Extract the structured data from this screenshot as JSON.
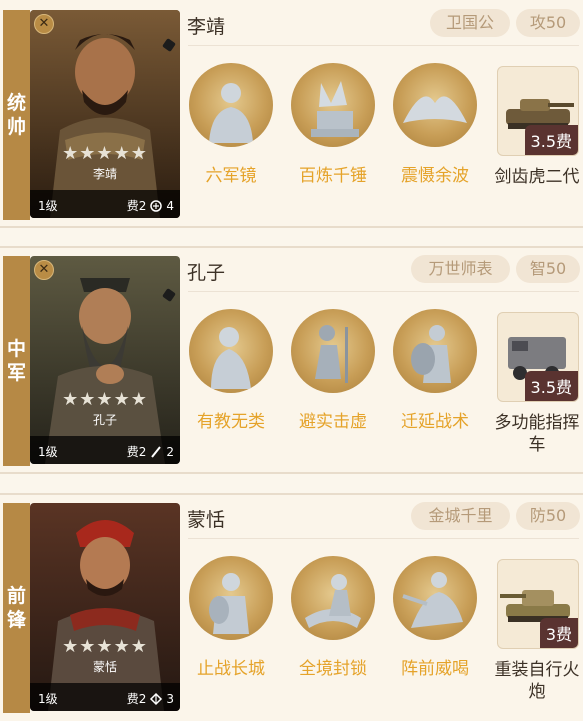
{
  "cards": [
    {
      "role": "统帅",
      "general": {
        "name": "李靖",
        "stars": "★★★★★",
        "level": "1级",
        "cost": "费2",
        "unit_count": "4"
      },
      "tags": [
        "卫国公",
        "攻50"
      ],
      "skills": [
        "六军镜",
        "百炼千锤",
        "震慑余波"
      ],
      "vehicle": {
        "fee": "3.5费",
        "name": "剑齿虎二代"
      },
      "colors": {
        "bg": "#6b4a2a",
        "armor": "#5a4a38"
      }
    },
    {
      "role": "中军",
      "general": {
        "name": "孔子",
        "stars": "★★★★★",
        "level": "1级",
        "cost": "费2",
        "unit_count": "2"
      },
      "tags": [
        "万世师表",
        "智50"
      ],
      "skills": [
        "有教无类",
        "避实击虚",
        "迁延战术"
      ],
      "vehicle": {
        "fee": "3.5费",
        "name": "多功能指挥车"
      },
      "colors": {
        "bg": "#4a4a3a",
        "armor": "#3a3a2e"
      }
    },
    {
      "role": "前锋",
      "general": {
        "name": "蒙恬",
        "stars": "★★★★★",
        "level": "1级",
        "cost": "费2",
        "unit_count": "3"
      },
      "tags": [
        "金城千里",
        "防50"
      ],
      "skills": [
        "止战长城",
        "全境封锁",
        "阵前威喝"
      ],
      "vehicle": {
        "fee": "3费",
        "name": "重装自行火炮"
      },
      "colors": {
        "bg": "#5a3a2a",
        "armor": "#4a3a2e"
      }
    }
  ],
  "icons": {
    "close": "close-icon",
    "unit": "unit-icon",
    "lock": "pin-icon"
  }
}
